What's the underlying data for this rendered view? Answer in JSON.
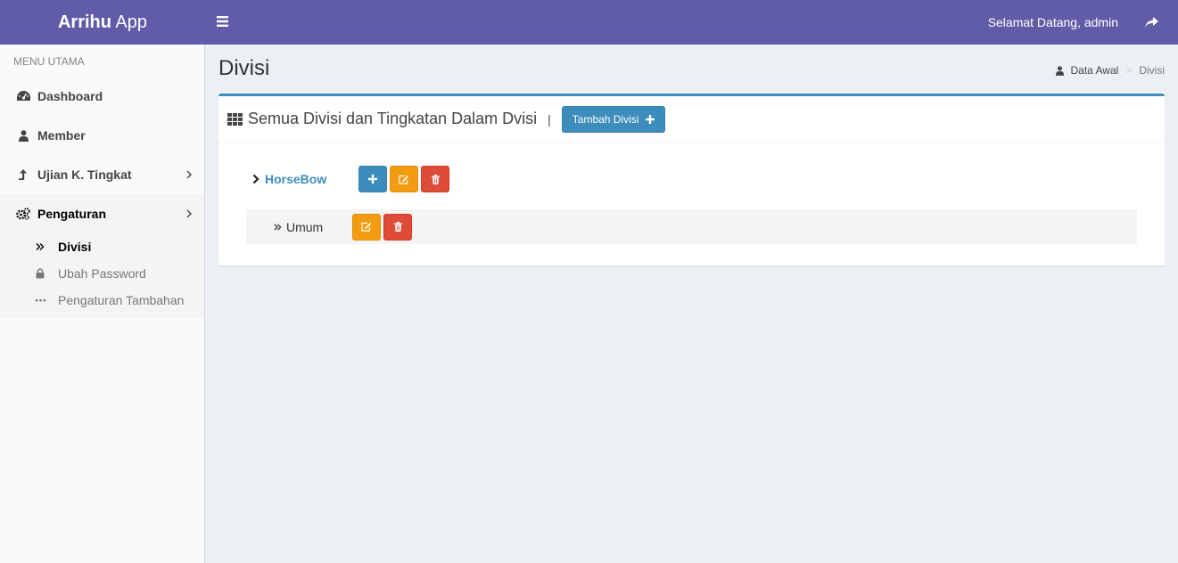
{
  "header": {
    "logo_bold": "Arrihu",
    "logo_light": "App",
    "welcome": "Selamat Datang, admin",
    "colors": {
      "header": "#605ca8"
    }
  },
  "sidebar": {
    "section_header": "MENU UTAMA",
    "items": [
      {
        "label": "Dashboard",
        "icon": "dashboard-icon"
      },
      {
        "label": "Member",
        "icon": "user-icon"
      },
      {
        "label": "Ujian K. Tingkat",
        "icon": "level-up-icon",
        "has_children": true
      },
      {
        "label": "Pengaturan",
        "icon": "gears-icon",
        "has_children": true,
        "expanded": true
      }
    ],
    "submenu": [
      {
        "label": "Divisi",
        "icon": "double-chevron-icon",
        "active": true
      },
      {
        "label": "Ubah Password",
        "icon": "lock-icon"
      },
      {
        "label": "Pengaturan Tambahan",
        "icon": "ellipsis-icon"
      }
    ]
  },
  "page": {
    "title": "Divisi",
    "breadcrumb": [
      {
        "label": "Data Awal",
        "icon": "user-icon"
      },
      {
        "label": "Divisi"
      }
    ]
  },
  "box": {
    "title": "Semua Divisi dan Tingkatan Dalam Dvisi",
    "separator": "|",
    "add_button": "Tambah Divisi",
    "accent": "#3c8dbc"
  },
  "tree": {
    "parent": {
      "label": "HorseBow"
    },
    "children": [
      {
        "label": "Umum"
      }
    ]
  }
}
